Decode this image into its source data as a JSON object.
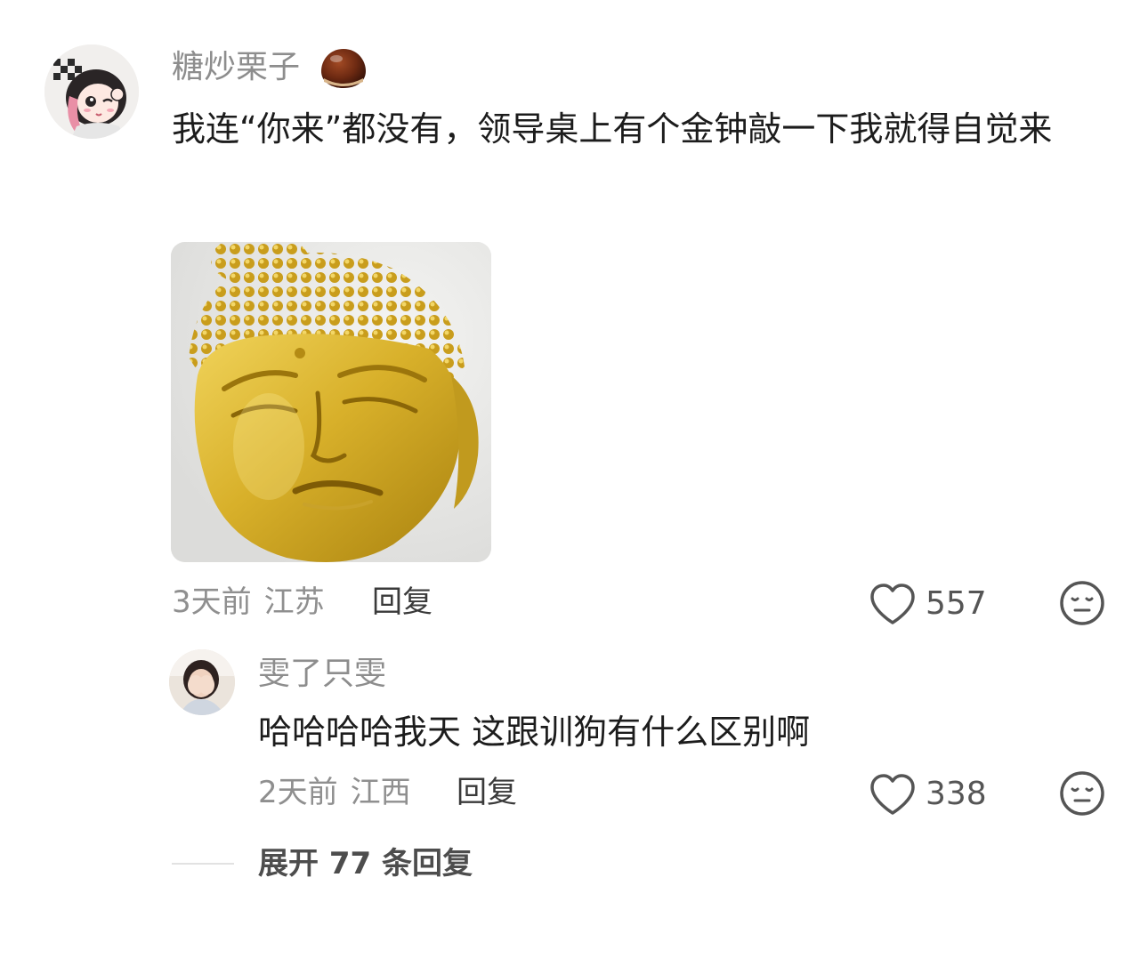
{
  "comment": {
    "username": "糖炒栗子",
    "badge_icon": "chestnut-icon",
    "text": "我连“你来”都没有，领导桌上有个金钟敲一下我就得自觉来",
    "sticker_icon": "golden-buddha-head-sticker",
    "time": "3天前",
    "location": "江苏",
    "reply_label": "回复",
    "like_count": "557"
  },
  "reply": {
    "username": "雯了只雯",
    "text": "哈哈哈哈我天 这跟训狗有什么区别啊",
    "time": "2天前",
    "location": "江西",
    "reply_label": "回复",
    "like_count": "338"
  },
  "expand": {
    "label": "展开 77 条回复"
  },
  "colors": {
    "username": "#8d8d8d",
    "meta": "#8f8f8f",
    "text": "#1c1c1c",
    "gold": "#d8b02a"
  }
}
